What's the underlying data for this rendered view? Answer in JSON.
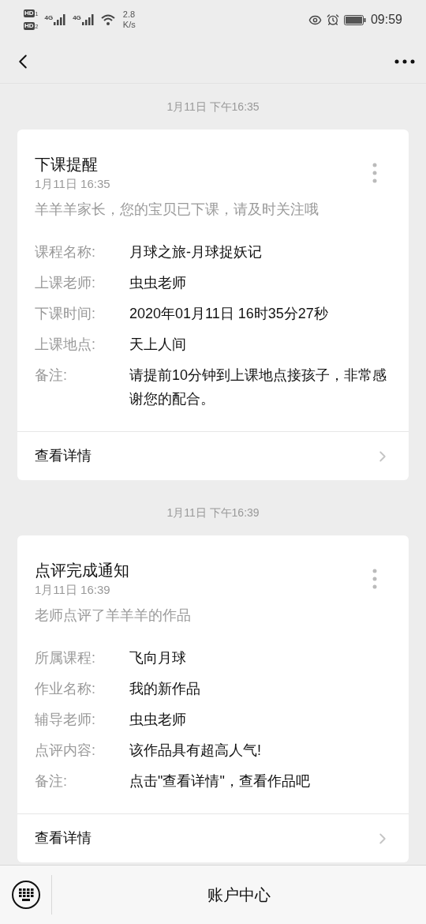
{
  "status_bar": {
    "sims": [
      {
        "badge": "HD",
        "slot": "1"
      },
      {
        "badge": "HD",
        "slot": "2"
      }
    ],
    "networks": [
      "4G",
      "4G"
    ],
    "speed": [
      "2.8",
      "K/s"
    ],
    "time": "09:59"
  },
  "messages": [
    {
      "timestamp": "1月11日 下午16:35",
      "title": "下课提醒",
      "date": "1月11日  16:35",
      "summary": "羊羊羊家长，您的宝贝已下课，请及时关注哦",
      "fields": [
        {
          "label": "课程名称:",
          "value": "月球之旅-月球捉妖记"
        },
        {
          "label": "上课老师:",
          "value": "虫虫老师"
        },
        {
          "label": "下课时间:",
          "value": "2020年01月11日 16时35分27秒"
        },
        {
          "label": "上课地点:",
          "value": "天上人间"
        },
        {
          "label": "备注:",
          "value": "请提前10分钟到上课地点接孩子，非常感谢您的配合。"
        }
      ],
      "link": "查看详情"
    },
    {
      "timestamp": "1月11日 下午16:39",
      "title": "点评完成通知",
      "date": "1月11日  16:39",
      "summary": "老师点评了羊羊羊的作品",
      "fields": [
        {
          "label": "所属课程:",
          "value": "飞向月球"
        },
        {
          "label": "作业名称:",
          "value": "我的新作品"
        },
        {
          "label": "辅导老师:",
          "value": "虫虫老师"
        },
        {
          "label": "点评内容:",
          "value": "该作品具有超高人气!"
        },
        {
          "label": "备注:",
          "value": "点击\"查看详情\"，查看作品吧"
        }
      ],
      "link": "查看详情"
    }
  ],
  "bottom_bar": {
    "menu": "账户中心"
  }
}
